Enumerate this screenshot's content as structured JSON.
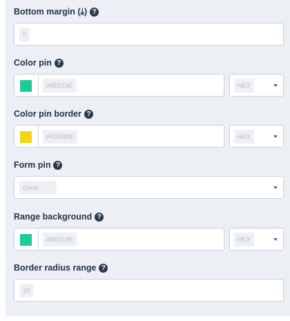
{
  "fields": {
    "bottom_margin": {
      "label": "Bottom margin (⤓)",
      "value": "0"
    },
    "color_pin": {
      "label": "Color pin",
      "value": "#0ED19E",
      "swatch": "#1ec99a",
      "format": "HEX"
    },
    "color_pin_border": {
      "label": "Color pin border",
      "value": "#FDD80E",
      "swatch": "#f5d412",
      "format": "HEX"
    },
    "form_pin": {
      "label": "Form pin",
      "value": "Circle"
    },
    "range_background": {
      "label": "Range background",
      "value": "#0ED19E",
      "swatch": "#1ec99a",
      "format": "HEX"
    },
    "border_radius_range": {
      "label": "Border radius range",
      "value": "10"
    }
  },
  "icons": {
    "help": "question-circle-icon",
    "dropdown": "chevron-down-icon"
  }
}
